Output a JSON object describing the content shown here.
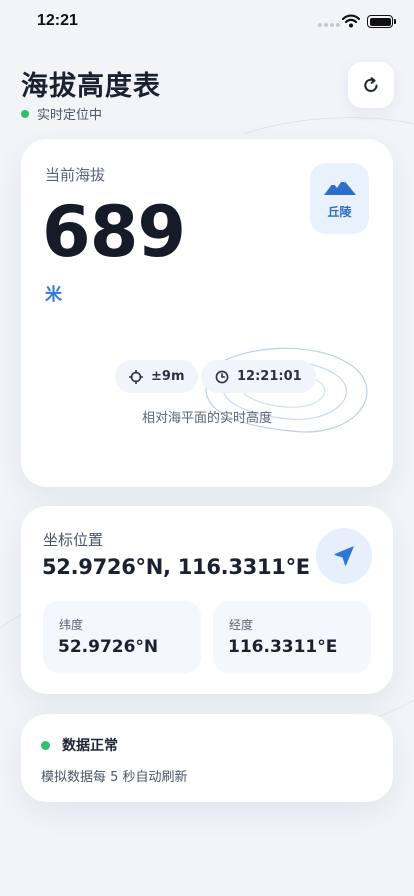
{
  "status_bar": {
    "time": "12:21"
  },
  "header": {
    "title": "海拔高度表",
    "location_status": "实时定位中"
  },
  "altitude": {
    "label": "当前海拔",
    "value": "689",
    "unit": "米",
    "terrain": {
      "label": "丘陵",
      "icon": "mountain-icon"
    },
    "accuracy": "±9m",
    "time": "12:21:01",
    "caption": "相对海平面的实时高度"
  },
  "coordinates": {
    "label": "坐标位置",
    "combined": "52.9726°N, 116.3311°E",
    "latitude": {
      "label": "纬度",
      "value": "52.9726°N"
    },
    "longitude": {
      "label": "经度",
      "value": "116.3311°E"
    }
  },
  "data_status": {
    "label": "数据正常",
    "note": "模拟数据每 5 秒自动刷新"
  },
  "colors": {
    "accent": "#2f78d8",
    "status_ok": "#2ec06a",
    "background": "#f2f4f8"
  }
}
